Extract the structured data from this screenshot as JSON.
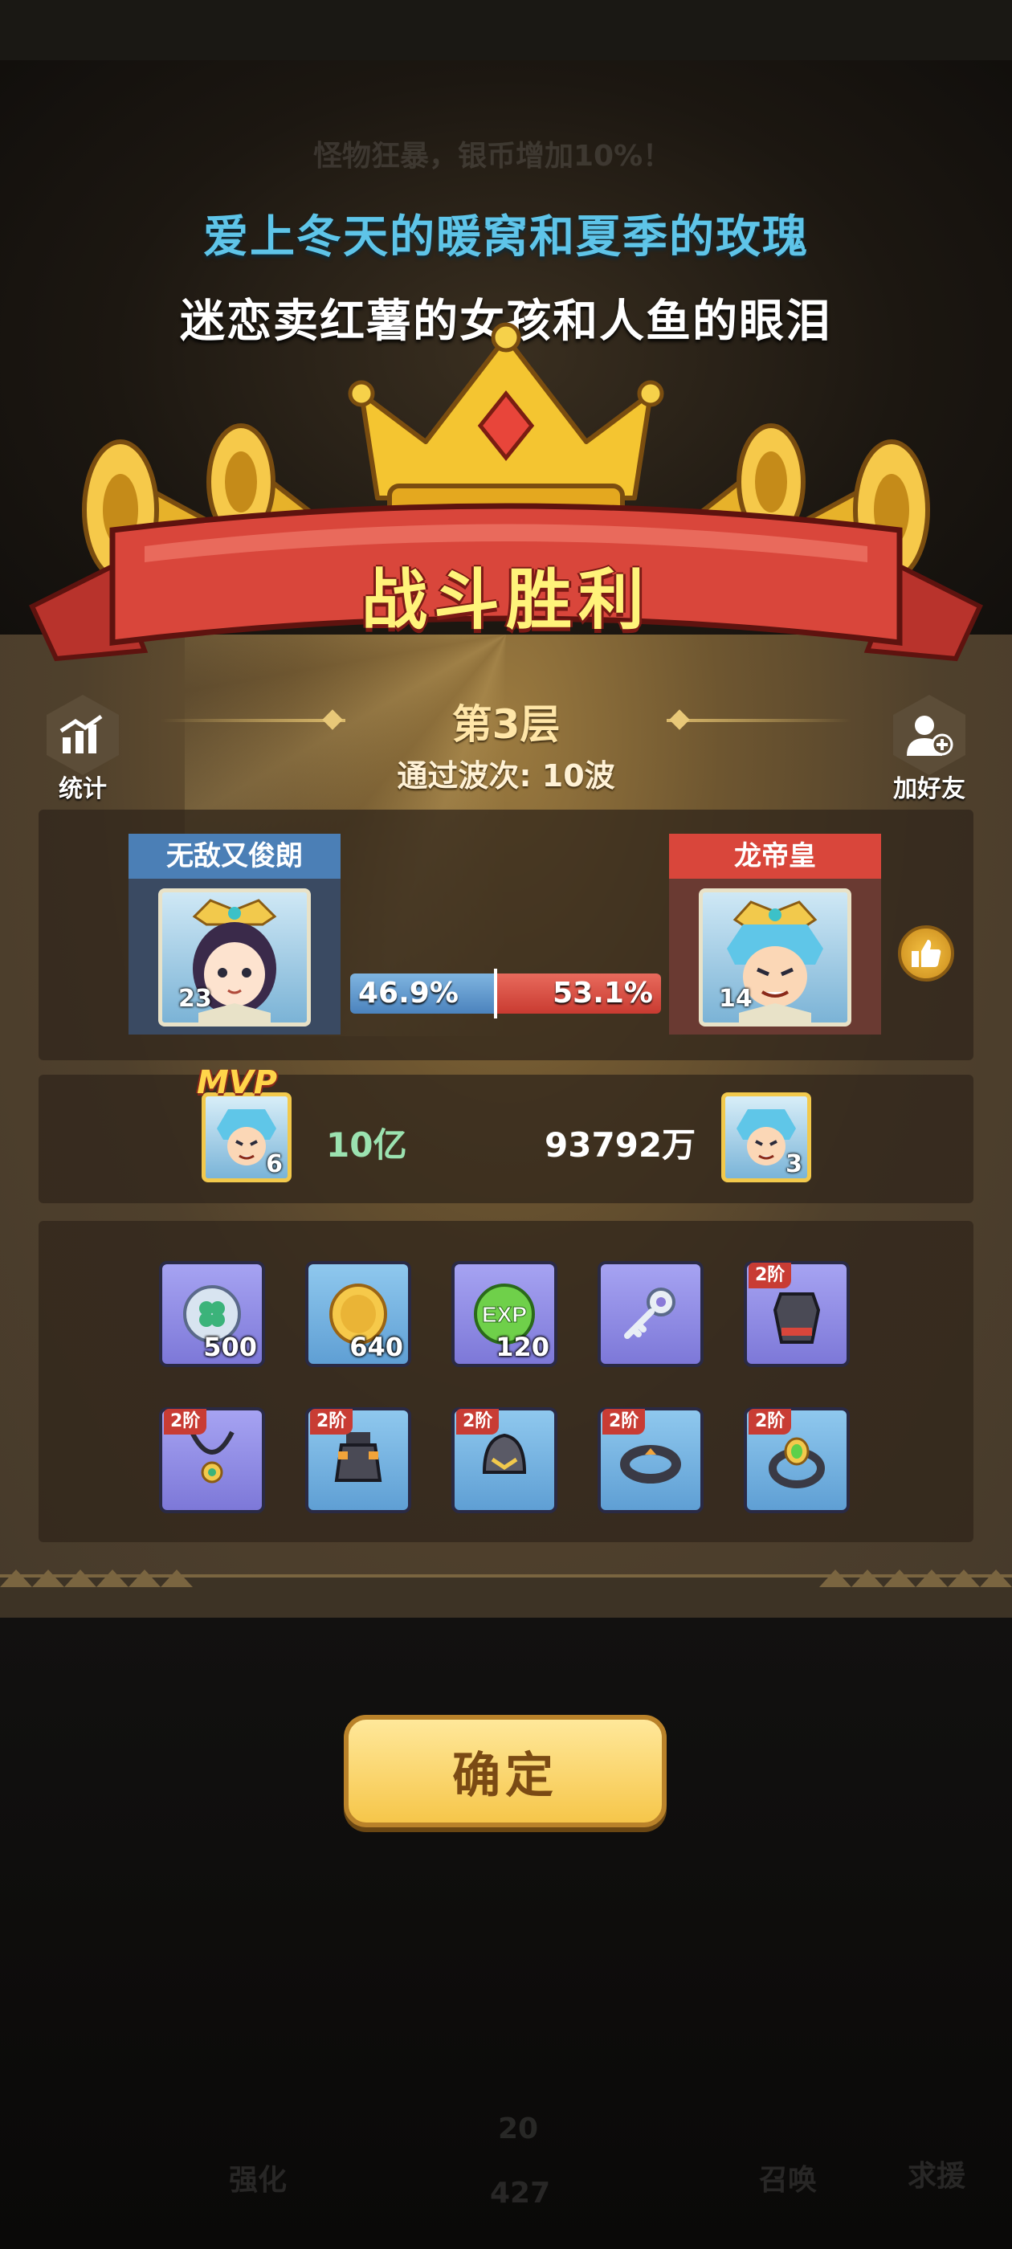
{
  "lyrics": {
    "line1": "爱上冬天的暖窝和夏季的玫瑰",
    "line2": "迷恋卖红薯的女孩和人鱼的眼泪"
  },
  "banner": {
    "title": "战斗胜利"
  },
  "header": {
    "floor": "第3层",
    "waves": "通过波次: 10波",
    "stats_label": "统计",
    "add_friend_label": "加好友"
  },
  "players": {
    "left": {
      "name": "无敌又俊朗",
      "level": "23",
      "percent": "46.9%"
    },
    "right": {
      "name": "龙帝皇",
      "level": "14",
      "percent": "53.1%"
    }
  },
  "mvp": {
    "badge": "MVP",
    "left": {
      "hero_level": "6",
      "damage": "10亿"
    },
    "right": {
      "hero_level": "3",
      "damage": "93792万"
    }
  },
  "rewards": [
    {
      "icon": "clover-coin-icon",
      "qty": "500",
      "tier": ""
    },
    {
      "icon": "gold-coin-icon",
      "qty": "640",
      "tier": ""
    },
    {
      "icon": "exp-orb-icon",
      "qty": "120",
      "tier": ""
    },
    {
      "icon": "key-icon",
      "qty": "",
      "tier": ""
    },
    {
      "icon": "armor-icon",
      "qty": "",
      "tier": "2阶"
    },
    {
      "icon": "necklace-icon",
      "qty": "",
      "tier": "2阶"
    },
    {
      "icon": "vase-icon",
      "qty": "",
      "tier": "2阶"
    },
    {
      "icon": "helmet-icon",
      "qty": "",
      "tier": "2阶"
    },
    {
      "icon": "ring-icon",
      "qty": "",
      "tier": "2阶"
    },
    {
      "icon": "gem-ring-icon",
      "qty": "",
      "tier": "2阶"
    }
  ],
  "confirm_label": "确定",
  "background": {
    "ghost_top": "怪物狂暴，银币增加10%！",
    "ghost_count": "20",
    "ghost_count2": "427",
    "ghost_btn1": "强化",
    "ghost_btn2": "召唤",
    "ghost_btn3": "求援"
  },
  "colors": {
    "lyric_blue": "#5ec4e8",
    "banner_red": "#d9463b",
    "win_blue": "#4b83bd",
    "lose_red": "#c93b31",
    "confirm_gold": "#f6c64a"
  }
}
